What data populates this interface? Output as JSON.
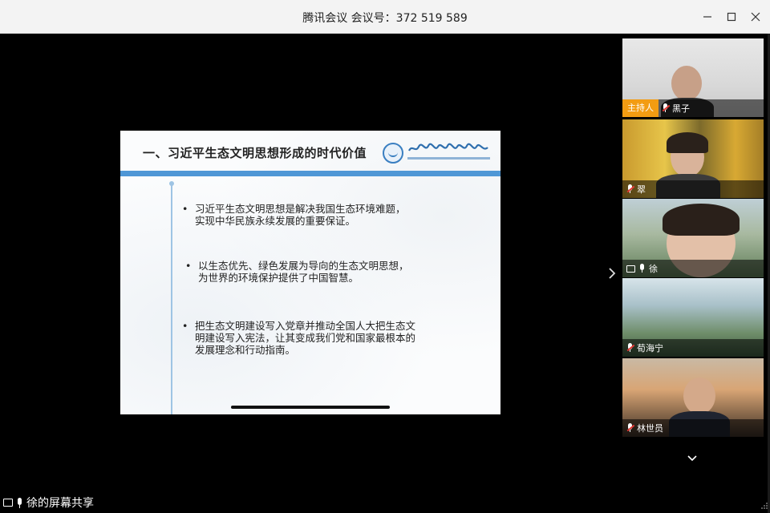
{
  "window": {
    "title": "腾讯会议 会议号：372 519 589"
  },
  "slide": {
    "title": "一、习近平生态文明思想形成的时代价值",
    "bullets": [
      "习近平生态文明思想是解决我国生态环境难题，实现中华民族永续发展的重要保证。",
      "以生态优先、绿色发展为导向的生态文明思想，为世界的环境保护提供了中国智慧。",
      "把生态文明建设写入党章并推动全国人大把生态文明建设写入宪法，让其变成我们党和国家最根本的发展理念和行动指南。"
    ],
    "bullet_symbol": "•"
  },
  "participants": [
    {
      "name": "黑子",
      "host_label": "主持人",
      "mic": "muted"
    },
    {
      "name": "翠",
      "mic": "muted"
    },
    {
      "name": "徐",
      "mic": "on",
      "sharing": true
    },
    {
      "name": "荀海宁",
      "mic": "muted"
    },
    {
      "name": "林世员",
      "mic": "muted"
    }
  ],
  "status": {
    "sharing_text": "徐的屏幕共享"
  },
  "icons": {
    "minimize": "minimize-icon",
    "maximize": "maximize-icon",
    "close": "close-icon",
    "next": "chevron-right-icon",
    "expand": "chevron-down-icon"
  },
  "colors": {
    "slide_accent": "#4f97d6",
    "host_badge": "#f39c12",
    "muted_red": "#e53935"
  }
}
